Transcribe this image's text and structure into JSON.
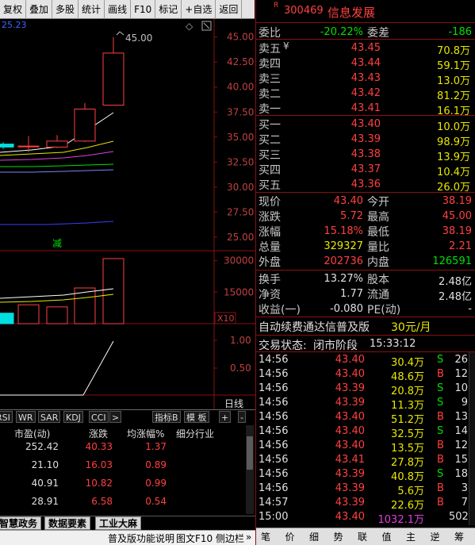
{
  "toolbar": {
    "items": [
      "复权",
      "叠加",
      "多股",
      "统计",
      "画线",
      "F10",
      "标记",
      "+自选",
      "返回"
    ]
  },
  "chart": {
    "top_left_value": "25.23",
    "price_label_high": "45.00",
    "price_axis": [
      "45.00",
      "42.50",
      "40.00",
      "37.50",
      "35.00",
      "32.50",
      "30.00",
      "27.50",
      "25.00"
    ],
    "volume_axis": [
      "30000",
      "15000"
    ],
    "volume_unit": "X10",
    "indicator_axis": [
      "1.00",
      "0.50"
    ],
    "period_label": "日线",
    "reduce_marker": "减"
  },
  "chart_data": {
    "type": "candlestick",
    "candles": [
      {
        "open": 34.3,
        "close": 34.0,
        "high": 34.5,
        "low": 33.8
      },
      {
        "open": 34.1,
        "close": 34.1,
        "high": 35.1,
        "low": 33.5
      },
      {
        "open": 34.0,
        "close": 34.6,
        "high": 35.2,
        "low": 33.9
      },
      {
        "open": 34.6,
        "close": 37.8,
        "high": 38.4,
        "low": 34.5
      },
      {
        "open": 38.19,
        "close": 43.4,
        "high": 45.0,
        "low": 38.19
      }
    ],
    "volumes": [
      5000,
      9000,
      8000,
      17000,
      31000
    ],
    "ylim": [
      23.8,
      46.8
    ]
  },
  "indicators": {
    "tabs": [
      "RSI",
      "WR",
      "SAR",
      "KDJ",
      "CCI"
    ],
    "more": ">",
    "right_tabs": [
      "指标B",
      "模 板",
      "+",
      "-"
    ]
  },
  "table": {
    "headers": [
      "市盈(动)",
      "涨跌",
      "均涨幅%",
      "细分行业"
    ],
    "rows": [
      [
        "252.42",
        "40.33",
        "1.37"
      ],
      [
        "21.10",
        "16.03",
        "0.89"
      ],
      [
        "40.91",
        "10.82",
        "0.99"
      ],
      [
        "28.91",
        "6.58",
        "0.54"
      ]
    ]
  },
  "bottom_tabs": [
    "智慧政务",
    "数据要素",
    "工业大麻"
  ],
  "status_bar": {
    "left": "普及版功能说明",
    "tab1": "图文F10",
    "tab2": "侧边栏",
    "arrows": "»"
  },
  "stock": {
    "flag": "R",
    "code": "300469",
    "name": "信息发展"
  },
  "weibi": {
    "label1": "委比",
    "val1": "-20.22%",
    "label2": "委差",
    "val2": "-186"
  },
  "sell": [
    {
      "label": "卖五",
      "mark": "¥",
      "price": "43.45",
      "vol": "70.8万"
    },
    {
      "label": "卖四",
      "mark": "",
      "price": "43.44",
      "vol": "59.1万"
    },
    {
      "label": "卖三",
      "mark": "",
      "price": "43.43",
      "vol": "13.0万"
    },
    {
      "label": "卖二",
      "mark": "",
      "price": "43.42",
      "vol": "81.2万"
    },
    {
      "label": "卖一",
      "mark": "",
      "price": "43.41",
      "vol": "16.1万"
    }
  ],
  "buy": [
    {
      "label": "买一",
      "price": "43.40",
      "vol": "10.0万"
    },
    {
      "label": "买二",
      "price": "43.39",
      "vol": "98.9万"
    },
    {
      "label": "买三",
      "price": "43.38",
      "vol": "13.9万"
    },
    {
      "label": "买四",
      "price": "43.37",
      "vol": "10.4万"
    },
    {
      "label": "买五",
      "price": "43.36",
      "vol": "26.0万"
    }
  ],
  "quote": [
    {
      "l1": "现价",
      "v1": "43.40",
      "l2": "今开",
      "v2": "38.19"
    },
    {
      "l1": "涨跌",
      "v1": "5.72",
      "l2": "最高",
      "v2": "45.00"
    },
    {
      "l1": "涨幅",
      "v1": "15.18%",
      "l2": "最低",
      "v2": "38.19"
    },
    {
      "l1": "总量",
      "v1": "329327",
      "l2": "量比",
      "v2": "2.21"
    },
    {
      "l1": "外盘",
      "v1": "202736",
      "l2": "内盘",
      "v2": "126591"
    }
  ],
  "fund": [
    {
      "l1": "换手",
      "v1": "13.27%",
      "l2": "股本",
      "v2": "2.48亿"
    },
    {
      "l1": "净资",
      "v1": "1.77",
      "l2": "流通",
      "v2": "2.48亿"
    },
    {
      "l1": "收益(一)",
      "v1": "-0.080",
      "l2": "PE(动)",
      "v2": "-"
    }
  ],
  "promo": {
    "text": "自动续费通达信普及版",
    "price": "30元/月"
  },
  "trade_state": {
    "label": "交易状态:",
    "state": "闭市阶段",
    "time": "15:33:12"
  },
  "ticks": [
    {
      "time": "14:56",
      "price": "43.40",
      "vol": "30.4万",
      "bs": "S",
      "n": "26"
    },
    {
      "time": "14:56",
      "price": "43.40",
      "vol": "48.6万",
      "bs": "B",
      "n": "12"
    },
    {
      "time": "14:56",
      "price": "43.39",
      "vol": "20.8万",
      "bs": "S",
      "n": "10"
    },
    {
      "time": "14:56",
      "price": "43.39",
      "vol": "11.3万",
      "bs": "S",
      "n": "9"
    },
    {
      "time": "14:56",
      "price": "43.40",
      "vol": "51.2万",
      "bs": "B",
      "n": "13"
    },
    {
      "time": "14:56",
      "price": "43.40",
      "vol": "32.5万",
      "bs": "S",
      "n": "14"
    },
    {
      "time": "14:56",
      "price": "43.40",
      "vol": "13.5万",
      "bs": "B",
      "n": "12"
    },
    {
      "time": "14:56",
      "price": "43.41",
      "vol": "27.8万",
      "bs": "B",
      "n": "15"
    },
    {
      "time": "14:56",
      "price": "43.39",
      "vol": "40.8万",
      "bs": "S",
      "n": "18"
    },
    {
      "time": "14:56",
      "price": "43.39",
      "vol": "5.6万",
      "bs": "B",
      "n": "3"
    },
    {
      "time": "14:57",
      "price": "43.39",
      "vol": "22.6万",
      "bs": "B",
      "n": "7"
    },
    {
      "time": "15:00",
      "price": "43.40",
      "vol": "1032.1万",
      "bs": "",
      "n": "502"
    }
  ],
  "right_tabs": [
    "笔",
    "价",
    "细",
    "势",
    "联",
    "值",
    "主",
    "逆",
    "筹"
  ],
  "colors": {
    "up": "#ff4040",
    "down": "#00e000",
    "volume_text": "#e8e800",
    "accent": "#00c0c0"
  }
}
